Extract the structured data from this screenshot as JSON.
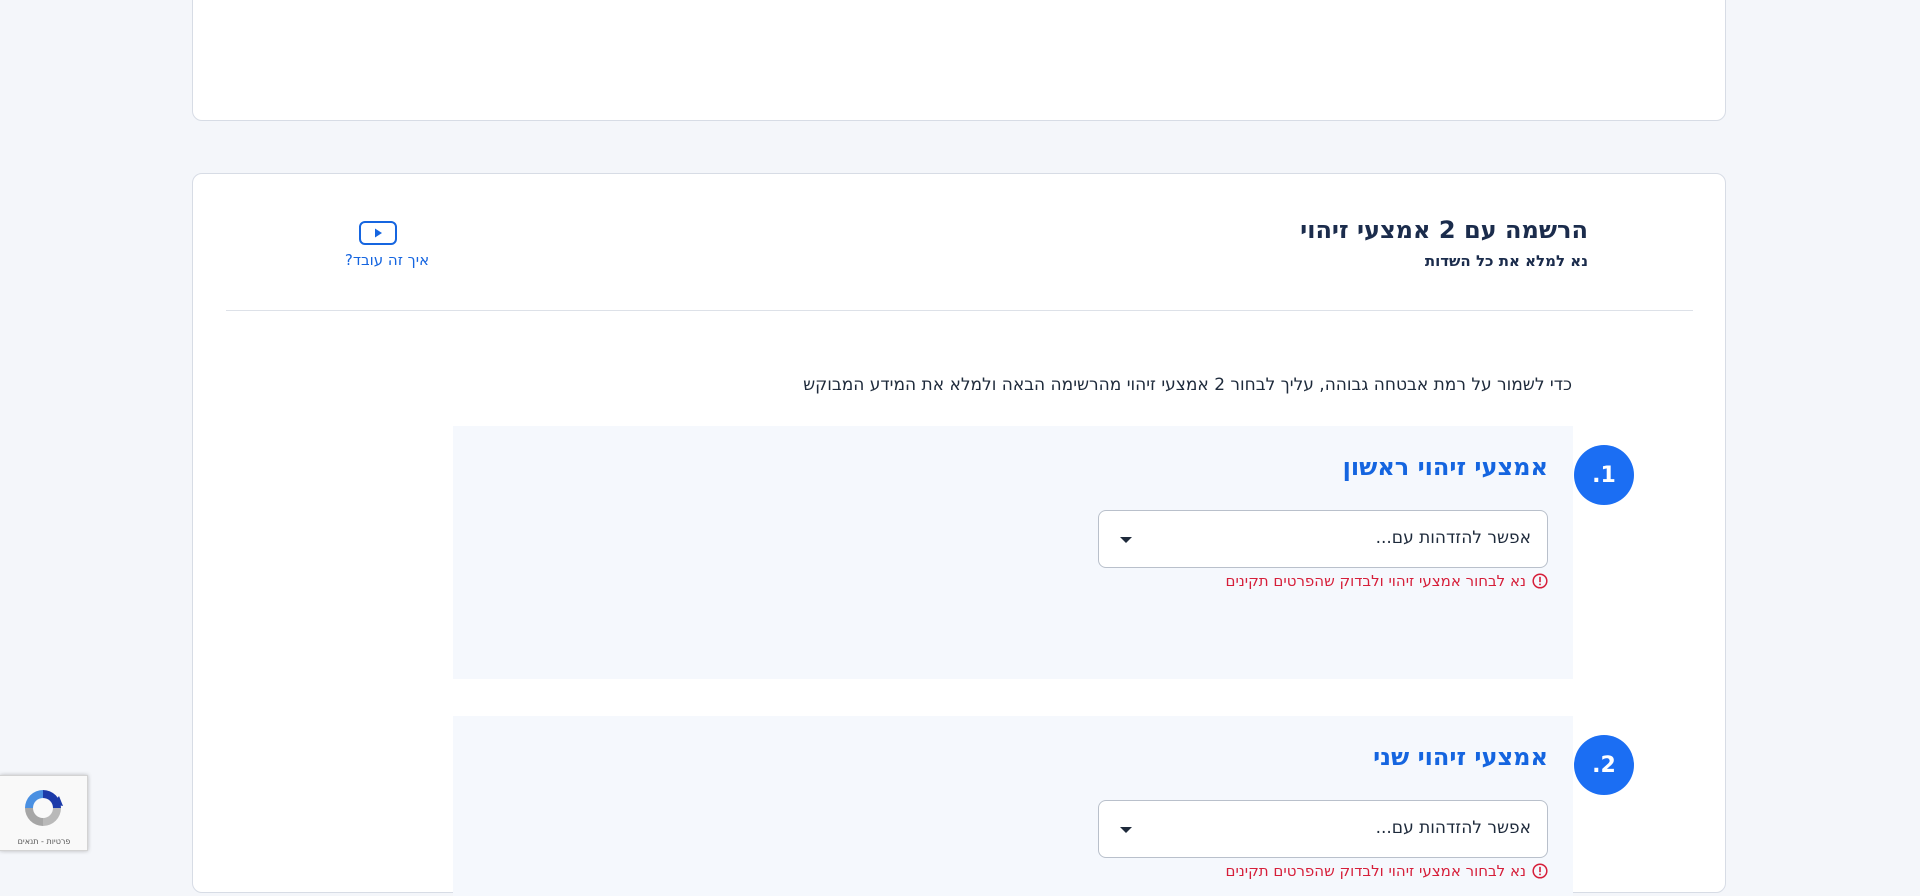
{
  "registration": {
    "title": "הרשמה עם 2 אמצעי זיהוי",
    "subtitle": "נא למלא את כל השדות",
    "how_it_works": "איך זה עובד?",
    "intro": "כדי לשמור על רמת אבטחה גבוהה, עליך לבחור 2 אמצעי זיהוי מהרשימה הבאה ולמלא את המידע המבוקש"
  },
  "steps": [
    {
      "number": ".1",
      "title": "אמצעי זיהוי ראשון",
      "select_placeholder": "אפשר להזדהות עם...",
      "error": "נא לבחור אמצעי זיהוי ולבדוק שהפרטים תקינים"
    },
    {
      "number": ".2",
      "title": "אמצעי זיהוי שני",
      "select_placeholder": "אפשר להזדהות עם...",
      "error": "נא לבחור אמצעי זיהוי ולבדוק שהפרטים תקינים"
    }
  ],
  "recaptcha": {
    "links": "פרטיות - תנאים"
  },
  "colors": {
    "accent": "#1b6ef3",
    "link": "#1565e0",
    "error": "#d61f3a",
    "page_bg": "#f4f6fa",
    "panel_bg": "#f5f8fd"
  }
}
